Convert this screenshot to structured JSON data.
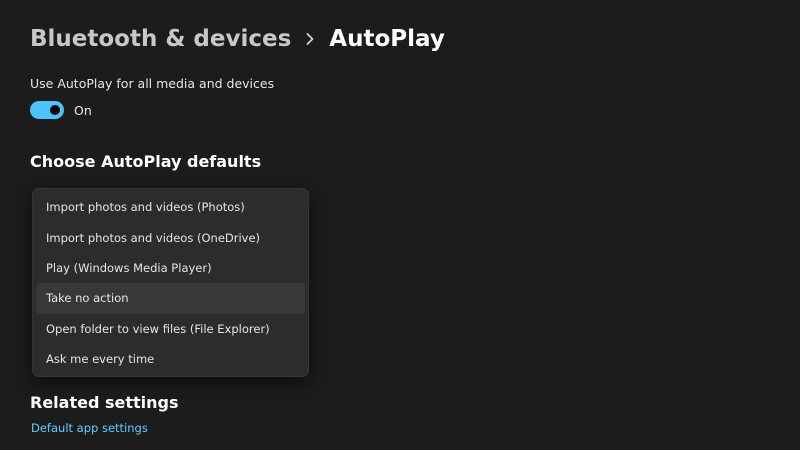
{
  "header": {
    "parent_label": "Bluetooth & devices",
    "current_label": "AutoPlay",
    "separator_icon": "chevron-right-icon"
  },
  "autoplay_toggle": {
    "label": "Use AutoPlay for all media and devices",
    "state_text": "On",
    "is_on": true,
    "accent_color": "#4cc2ff"
  },
  "defaults_section": {
    "heading": "Choose AutoPlay defaults",
    "options": [
      "Import photos and videos (Photos)",
      "Import photos and videos (OneDrive)",
      "Play (Windows Media Player)",
      "Take no action",
      "Open folder to view files (File Explorer)",
      "Ask me every time"
    ],
    "selected_option": "Take no action"
  },
  "related_section": {
    "heading": "Related settings",
    "link_label": "Default app settings",
    "link_color": "#60cdff"
  }
}
